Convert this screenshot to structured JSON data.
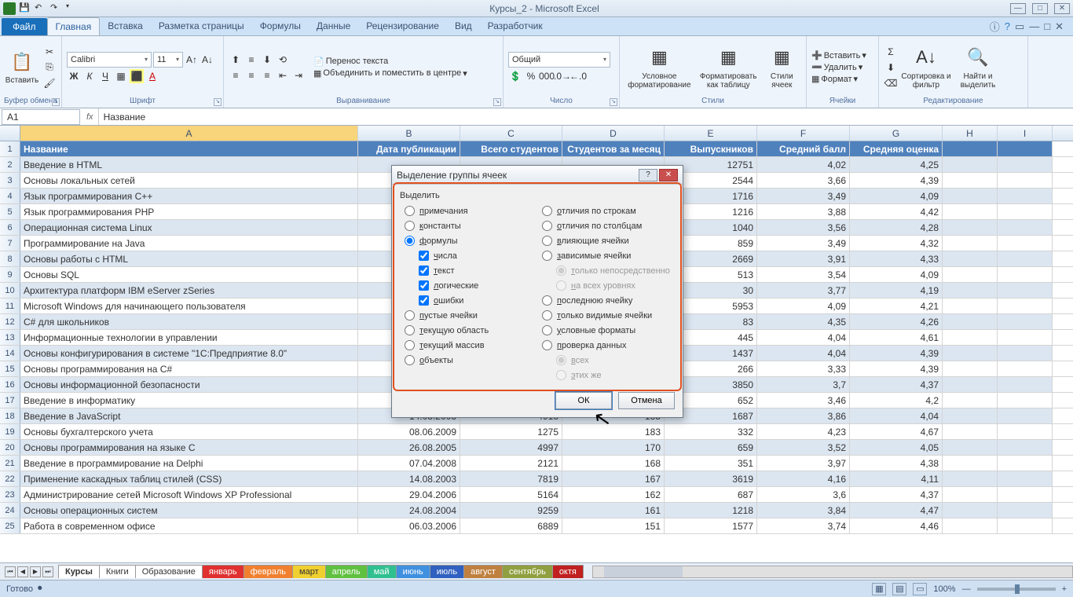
{
  "titlebar": {
    "title": "Курсы_2 - Microsoft Excel"
  },
  "filetab": "Файл",
  "tabs": [
    "Главная",
    "Вставка",
    "Разметка страницы",
    "Формулы",
    "Данные",
    "Рецензирование",
    "Вид",
    "Разработчик"
  ],
  "ribbon": {
    "clipboard": {
      "paste": "Вставить",
      "label": "Буфер обмена"
    },
    "font": {
      "name": "Calibri",
      "size": "11",
      "label": "Шрифт"
    },
    "align": {
      "wrap": "Перенос текста",
      "merge": "Объединить и поместить в центре",
      "label": "Выравнивание"
    },
    "number": {
      "format": "Общий",
      "label": "Число"
    },
    "styles": {
      "cond": "Условное форматирование",
      "fmttbl": "Форматировать как таблицу",
      "cellst": "Стили ячеек",
      "label": "Стили"
    },
    "cells": {
      "insert": "Вставить",
      "delete": "Удалить",
      "format": "Формат",
      "label": "Ячейки"
    },
    "editing": {
      "sort": "Сортировка и фильтр",
      "find": "Найти и выделить",
      "label": "Редактирование"
    }
  },
  "namebox": "A1",
  "formula": "Название",
  "columns": [
    "A",
    "B",
    "C",
    "D",
    "E",
    "F",
    "G",
    "H",
    "I"
  ],
  "headers": [
    "Название",
    "Дата публикации",
    "Всего студентов",
    "Студентов за месяц",
    "Выпускников",
    "Средний балл",
    "Средняя оценка"
  ],
  "rows": [
    [
      "Введение в HTML",
      "",
      "",
      "",
      "12751",
      "4,02",
      "4,25"
    ],
    [
      "Основы локальных сетей",
      "",
      "",
      "",
      "2544",
      "3,66",
      "4,39"
    ],
    [
      "Язык программирования C++",
      "",
      "",
      "",
      "1716",
      "3,49",
      "4,09"
    ],
    [
      "Язык программирования PHP",
      "",
      "",
      "",
      "1216",
      "3,88",
      "4,42"
    ],
    [
      "Операционная система Linux",
      "",
      "",
      "",
      "1040",
      "3,56",
      "4,28"
    ],
    [
      "Программирование на Java",
      "",
      "",
      "",
      "859",
      "3,49",
      "4,32"
    ],
    [
      "Основы работы с HTML",
      "",
      "",
      "",
      "2669",
      "3,91",
      "4,33"
    ],
    [
      "Основы SQL",
      "",
      "",
      "",
      "513",
      "3,54",
      "4,09"
    ],
    [
      "Архитектура платформ IBM eServer zSeries",
      "",
      "",
      "",
      "30",
      "3,77",
      "4,19"
    ],
    [
      "Microsoft Windows для начинающего пользователя",
      "",
      "",
      "",
      "5953",
      "4,09",
      "4,21"
    ],
    [
      "C# для школьников",
      "",
      "",
      "",
      "83",
      "4,35",
      "4,26"
    ],
    [
      "Информационные технологии в управлении",
      "",
      "",
      "",
      "445",
      "4,04",
      "4,61"
    ],
    [
      "Основы конфигурирования в системе \"1С:Предприятие 8.0\"",
      "",
      "",
      "",
      "1437",
      "4,04",
      "4,39"
    ],
    [
      "Основы программирования на C#",
      "",
      "",
      "",
      "266",
      "3,33",
      "4,39"
    ],
    [
      "Основы информационной безопасности",
      "",
      "",
      "",
      "3850",
      "3,7",
      "4,37"
    ],
    [
      "Введение в информатику",
      "",
      "",
      "",
      "652",
      "3,46",
      "4,2"
    ],
    [
      "Введение в JavaScript",
      "14.08.2003",
      "4918",
      "185",
      "1687",
      "3,86",
      "4,04"
    ],
    [
      "Основы бухгалтерского учета",
      "08.06.2009",
      "1275",
      "183",
      "332",
      "4,23",
      "4,67"
    ],
    [
      "Основы программирования на языке С",
      "26.08.2005",
      "4997",
      "170",
      "659",
      "3,52",
      "4,05"
    ],
    [
      "Введение в программирование на Delphi",
      "07.04.2008",
      "2121",
      "168",
      "351",
      "3,97",
      "4,38"
    ],
    [
      "Применение каскадных таблиц стилей (CSS)",
      "14.08.2003",
      "7819",
      "167",
      "3619",
      "4,16",
      "4,11"
    ],
    [
      "Администрирование сетей Microsoft Windows XP Professional",
      "29.04.2006",
      "5164",
      "162",
      "687",
      "3,6",
      "4,37"
    ],
    [
      "Основы операционных систем",
      "24.08.2004",
      "9259",
      "161",
      "1218",
      "3,84",
      "4,47"
    ],
    [
      "Работа в современном офисе",
      "06.03.2006",
      "6889",
      "151",
      "1577",
      "3,74",
      "4,46"
    ]
  ],
  "sheets": [
    {
      "name": "Курсы",
      "cls": "active"
    },
    {
      "name": "Книги",
      "cls": ""
    },
    {
      "name": "Образование",
      "cls": ""
    },
    {
      "name": "январь",
      "cls": "c-red"
    },
    {
      "name": "февраль",
      "cls": "c-ora"
    },
    {
      "name": "март",
      "cls": "c-yel"
    },
    {
      "name": "апрель",
      "cls": "c-grn"
    },
    {
      "name": "май",
      "cls": "c-teal"
    },
    {
      "name": "июнь",
      "cls": "c-blue"
    },
    {
      "name": "июль",
      "cls": "c-blu2"
    },
    {
      "name": "август",
      "cls": "c-brn"
    },
    {
      "name": "сентябрь",
      "cls": "c-olv"
    },
    {
      "name": "октя",
      "cls": "c-red2"
    }
  ],
  "status": {
    "ready": "Готово",
    "zoom": "100%"
  },
  "dialog": {
    "title": "Выделение группы ячеек",
    "heading": "Выделить",
    "left": [
      {
        "t": "radio",
        "label": "примечания",
        "sel": false
      },
      {
        "t": "radio",
        "label": "константы",
        "sel": false
      },
      {
        "t": "radio",
        "label": "формулы",
        "sel": true
      },
      {
        "t": "check",
        "label": "числа",
        "sel": true,
        "sub": true
      },
      {
        "t": "check",
        "label": "текст",
        "sel": true,
        "sub": true
      },
      {
        "t": "check",
        "label": "логические",
        "sel": true,
        "sub": true
      },
      {
        "t": "check",
        "label": "ошибки",
        "sel": true,
        "sub": true
      },
      {
        "t": "radio",
        "label": "пустые ячейки",
        "sel": false
      },
      {
        "t": "radio",
        "label": "текущую область",
        "sel": false
      },
      {
        "t": "radio",
        "label": "текущий массив",
        "sel": false
      },
      {
        "t": "radio",
        "label": "объекты",
        "sel": false
      }
    ],
    "right": [
      {
        "t": "radio",
        "label": "отличия по строкам",
        "sel": false
      },
      {
        "t": "radio",
        "label": "отличия по столбцам",
        "sel": false
      },
      {
        "t": "radio",
        "label": "влияющие ячейки",
        "sel": false
      },
      {
        "t": "radio",
        "label": "зависимые ячейки",
        "sel": false
      },
      {
        "t": "radio",
        "label": "только непосредственно",
        "sel": true,
        "sub": true,
        "dis": true
      },
      {
        "t": "radio",
        "label": "на всех уровнях",
        "sel": false,
        "sub": true,
        "dis": true
      },
      {
        "t": "radio",
        "label": "последнюю ячейку",
        "sel": false
      },
      {
        "t": "radio",
        "label": "только видимые ячейки",
        "sel": false
      },
      {
        "t": "radio",
        "label": "условные форматы",
        "sel": false
      },
      {
        "t": "radio",
        "label": "проверка данных",
        "sel": false
      },
      {
        "t": "radio",
        "label": "всех",
        "sel": true,
        "sub": true,
        "dis": true
      },
      {
        "t": "radio",
        "label": "этих же",
        "sel": false,
        "sub": true,
        "dis": true
      }
    ],
    "ok": "ОК",
    "cancel": "Отмена"
  }
}
